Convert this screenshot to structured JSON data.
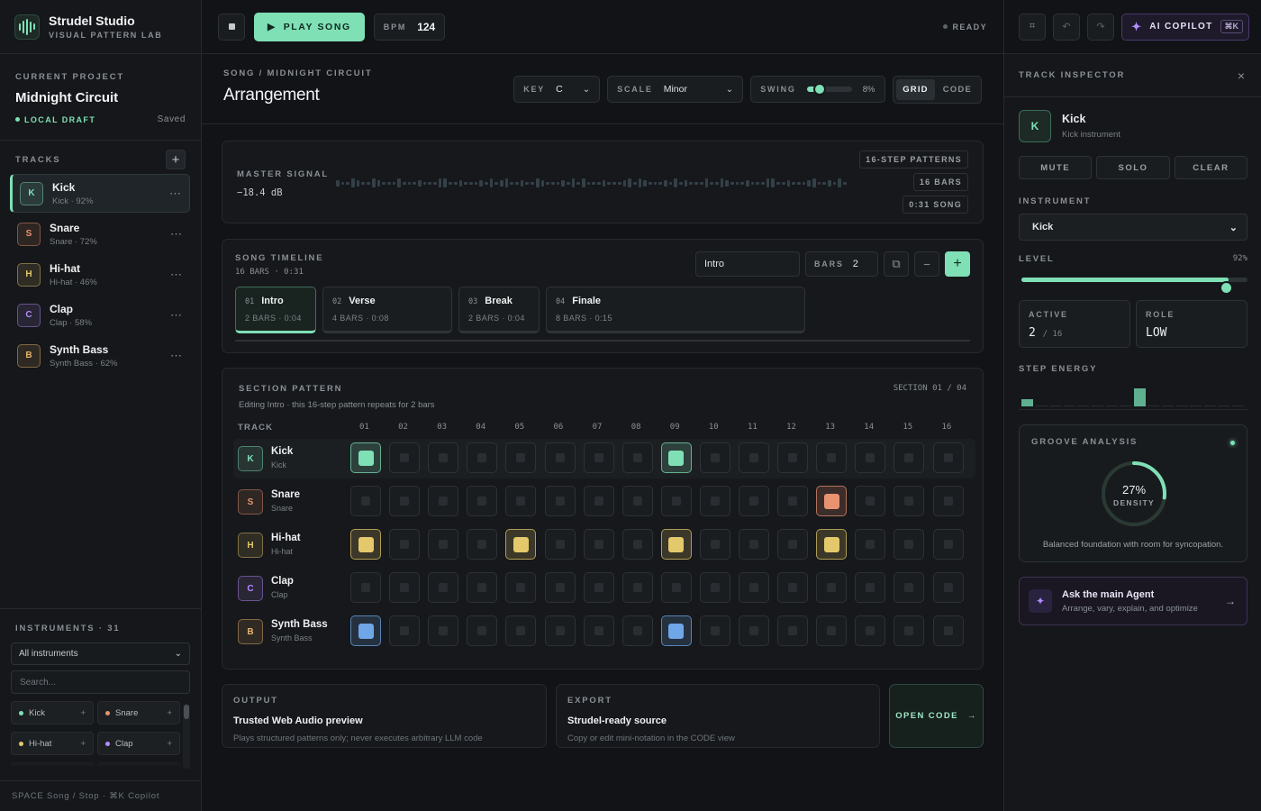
{
  "brand": {
    "title": "Strudel Studio",
    "subtitle": "VISUAL PATTERN LAB"
  },
  "project": {
    "label": "CURRENT PROJECT",
    "name": "Midnight Circuit",
    "status": "LOCAL DRAFT",
    "saved": "Saved"
  },
  "tracks": {
    "label": "TRACKS",
    "items": [
      {
        "letter": "K",
        "name": "Kick",
        "sub": "Kick · 92%",
        "color": "#7fe0b6"
      },
      {
        "letter": "S",
        "name": "Snare",
        "sub": "Snare · 72%",
        "color": "#e8926f"
      },
      {
        "letter": "H",
        "name": "Hi-hat",
        "sub": "Hi-hat · 46%",
        "color": "#e3c96b"
      },
      {
        "letter": "C",
        "name": "Clap",
        "sub": "Clap · 58%",
        "color": "#b38cff"
      },
      {
        "letter": "B",
        "name": "Synth Bass",
        "sub": "Synth Bass · 62%",
        "color": "#e9b36a"
      }
    ]
  },
  "instruments": {
    "label": "INSTRUMENTS · 31",
    "filter": "All instruments",
    "search_placeholder": "Search...",
    "chips": [
      {
        "name": "Kick",
        "color": "#7fe0b6"
      },
      {
        "name": "Snare",
        "color": "#e8926f"
      },
      {
        "name": "Hi-hat",
        "color": "#e3c96b"
      },
      {
        "name": "Clap",
        "color": "#b38cff"
      }
    ]
  },
  "footer": "SPACE Song / Stop · ⌘K Copilot",
  "toolbar": {
    "play": "PLAY SONG",
    "bpm_label": "BPM",
    "bpm": "124",
    "status": "READY"
  },
  "copilot": {
    "label": "AI COPILOT",
    "shortcut": "⌘K"
  },
  "header": {
    "breadcrumb": "SONG / MIDNIGHT CIRCUIT",
    "title": "Arrangement",
    "key_label": "KEY",
    "key": "C",
    "scale_label": "SCALE",
    "scale": "Minor",
    "swing_label": "SWING",
    "swing": "8%",
    "swing_value": 0.08,
    "view_grid": "GRID",
    "view_code": "CODE"
  },
  "signal": {
    "label": "MASTER SIGNAL",
    "value": "−18.4 dB",
    "tags": [
      "16-STEP PATTERNS",
      "16 BARS",
      "0:31 SONG"
    ]
  },
  "timeline": {
    "label": "SONG TIMELINE",
    "sub": "16 BARS · 0:31",
    "section_input": "Intro",
    "bars_label": "BARS",
    "bars": "2",
    "sections": [
      {
        "num": "01",
        "name": "Intro",
        "sub": "2 BARS · 0:04",
        "bars": 2
      },
      {
        "num": "02",
        "name": "Verse",
        "sub": "4 BARS · 0:08",
        "bars": 4
      },
      {
        "num": "03",
        "name": "Break",
        "sub": "2 BARS · 0:04",
        "bars": 2
      },
      {
        "num": "04",
        "name": "Finale",
        "sub": "8 BARS · 0:15",
        "bars": 8
      }
    ]
  },
  "pattern": {
    "label": "SECTION PATTERN",
    "sub": "Editing Intro · this 16-step pattern repeats for 2 bars",
    "counter": "SECTION 01 / 04",
    "track_col": "TRACK",
    "steps_header": [
      "01",
      "02",
      "03",
      "04",
      "05",
      "06",
      "07",
      "08",
      "09",
      "10",
      "11",
      "12",
      "13",
      "14",
      "15",
      "16"
    ],
    "rows": [
      {
        "letter": "K",
        "name": "Kick",
        "sub": "Kick",
        "color": "#7fe0b6",
        "active": [
          1,
          9
        ]
      },
      {
        "letter": "S",
        "name": "Snare",
        "sub": "Snare",
        "color": "#e8926f",
        "active": [
          13
        ]
      },
      {
        "letter": "H",
        "name": "Hi-hat",
        "sub": "Hi-hat",
        "color": "#e3c96b",
        "active": [
          1,
          5,
          9,
          13
        ]
      },
      {
        "letter": "C",
        "name": "Clap",
        "sub": "Clap",
        "color": "#b38cff",
        "active": []
      },
      {
        "letter": "B",
        "name": "Synth Bass",
        "sub": "Synth Bass",
        "color": "#e9b36a",
        "step_color": "#6ea6e8",
        "active": [
          1,
          9
        ]
      }
    ]
  },
  "output": {
    "label": "OUTPUT",
    "title": "Trusted Web Audio preview",
    "sub": "Plays structured patterns only; never executes arbitrary LLM code"
  },
  "export": {
    "label": "EXPORT",
    "title": "Strudel-ready source",
    "sub": "Copy or edit mini-notation in the CODE view"
  },
  "open_code": "OPEN CODE",
  "inspector": {
    "label": "TRACK INSPECTOR",
    "letter": "K",
    "name": "Kick",
    "sub": "Kick instrument",
    "mute": "MUTE",
    "solo": "SOLO",
    "clear": "CLEAR",
    "instrument_label": "INSTRUMENT",
    "instrument": "Kick",
    "level_label": "LEVEL",
    "level": "92%",
    "level_value": 0.92,
    "active_label": "ACTIVE",
    "active": "2",
    "active_total": "/ 16",
    "role_label": "ROLE",
    "role": "LOW",
    "energy_label": "STEP ENERGY",
    "energy": [
      1,
      0,
      0,
      0,
      0,
      0,
      0,
      0,
      1,
      0,
      0,
      0,
      0,
      0,
      0,
      0
    ]
  },
  "groove": {
    "label": "GROOVE ANALYSIS",
    "value": "27%",
    "value_fraction": 0.27,
    "unit": "DENSITY",
    "note": "Balanced foundation with room for syncopation."
  },
  "ask": {
    "title": "Ask the main Agent",
    "sub": "Arrange, vary, explain, and optimize"
  }
}
